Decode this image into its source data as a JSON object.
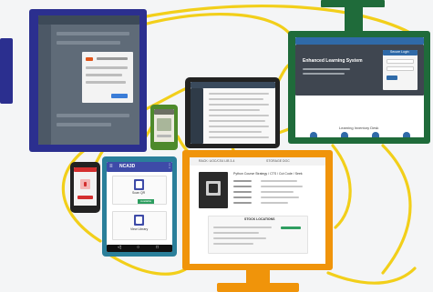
{
  "left_monitor": {
    "frame_color": "#2b2f8f"
  },
  "right_monitor": {
    "frame_color": "#1f6b3a",
    "page_heading": "Enhanced Learning System",
    "login_title": "Secure Login",
    "footer_title": "Learning Inventory Desk"
  },
  "tablet": {
    "frame_color": "#222222"
  },
  "small_phone": {
    "frame_color": "#4d8a2b"
  },
  "red_phone": {
    "frame_color": "#222222"
  },
  "teal_phone": {
    "frame_color": "#2a7f9a",
    "app_title": "NCA3D",
    "card1_label": "Scan QR",
    "card1_badge": "Available",
    "card2_label": "View Library"
  },
  "bottom_monitor": {
    "frame_color": "#f0940a",
    "header_left": "RACK: UOC/CS4 LIB 3-4",
    "header_right": "STORAGE DOC",
    "book_title": "Python Course Strategy / CTS / Cut Code / Seek",
    "section_title": "STOCK LOCATIONS"
  },
  "colors": {
    "wire": "#f2cf1a",
    "background": "#f4f5f6"
  }
}
